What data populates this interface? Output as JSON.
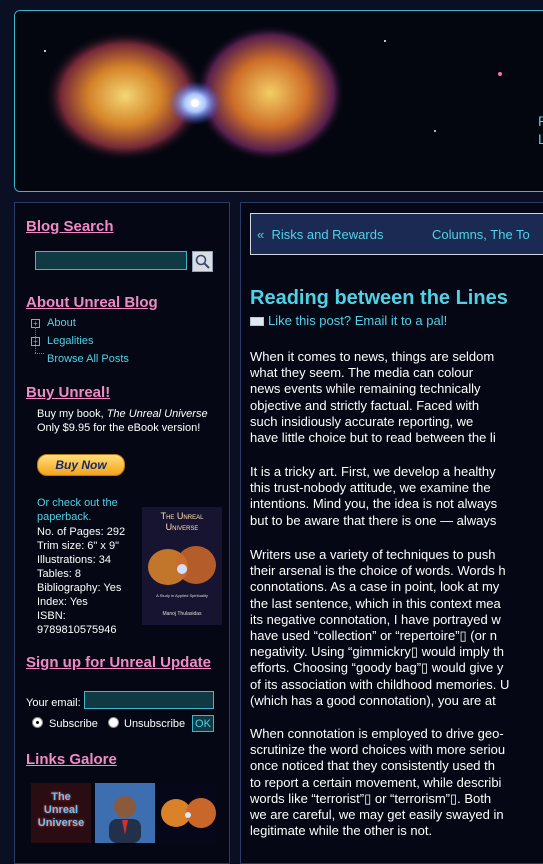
{
  "header": {
    "tagline_line1": "P",
    "tagline_line2": "L"
  },
  "sidebar": {
    "blog_search": {
      "title": "Blog Search",
      "input_value": "",
      "button_icon": "search-icon"
    },
    "about": {
      "title": "About Unreal Blog",
      "items": [
        "About",
        "Legalities"
      ],
      "browse_all": "Browse All Posts"
    },
    "buy": {
      "title": "Buy Unreal!",
      "line1_prefix": "Buy my book, ",
      "line1_book": "The Unreal Universe",
      "line2": "Only $9.95 for the eBook version!",
      "buy_now": "Buy Now",
      "paperback_line1": "Or check out the",
      "paperback_line2": "paperback.",
      "details": [
        "No. of Pages: 292",
        "Trim size: 6\" x 9\"",
        "Illustrations: 34",
        "Tables: 8",
        "Bibliography: Yes",
        "Index: Yes",
        "ISBN:",
        "9789810575946"
      ],
      "cover_title_line1": "The Unreal",
      "cover_title_line2": "Universe",
      "cover_subtitle": "A Study in Applied Spirituality",
      "cover_author": "Manoj Thulasidas"
    },
    "signup": {
      "title": "Sign up for Unreal Update",
      "email_label": "Your email:",
      "email_value": "",
      "subscribe": "Subscribe",
      "unsubscribe": "Unsubscribe",
      "ok": "OK",
      "selected": "subscribe"
    },
    "links": {
      "title": "Links Galore",
      "logo_line1": "The",
      "logo_line2": "Unreal",
      "logo_line3": "Universe"
    }
  },
  "main": {
    "nav": {
      "prev_arrow": "«",
      "prev": "Risks and Rewards",
      "next": "Columns, The To"
    },
    "post_title": "Reading between the Lines",
    "email_pal": "Like this post? Email it to a pal!",
    "paragraphs": [
      [
        "When it comes to news, things are seldom",
        "what they seem. The media can colour",
        "news events while remaining technically",
        "objective and strictly factual. Faced with",
        "such insidiously accurate reporting, we",
        "have little choice but to read between the li"
      ],
      [
        "It is a tricky art. First, we develop a healthy",
        "this trust-nobody attitude, we examine the",
        "intentions. Mind you, the idea is not always",
        "but to be aware that there is one — always"
      ],
      [
        "Writers use a variety of techniques to push",
        "their arsenal is the choice of words. Words h",
        "connotations. As a case in point, look at my",
        "the last sentence, which in this context mea",
        "its negative connotation, I have portrayed w",
        "have used “collection” or “repertoire”▯ (or n",
        "negativity. Using “gimmickry▯ would imply th",
        "efforts. Choosing “goody bag”▯ would give y",
        "of its association with childhood memories. U",
        "(which has a good connotation), you are at"
      ],
      [
        "When connotation is employed to drive geo-",
        "scrutinize the word choices with more seriou",
        "once noticed that they consistently used th",
        "to report a certain movement, while describi",
        "words like “terrorist”▯ or “terrorism”▯. Both",
        "we are careful, we may get easily swayed in",
        "legitimate while the other is not."
      ]
    ]
  }
}
